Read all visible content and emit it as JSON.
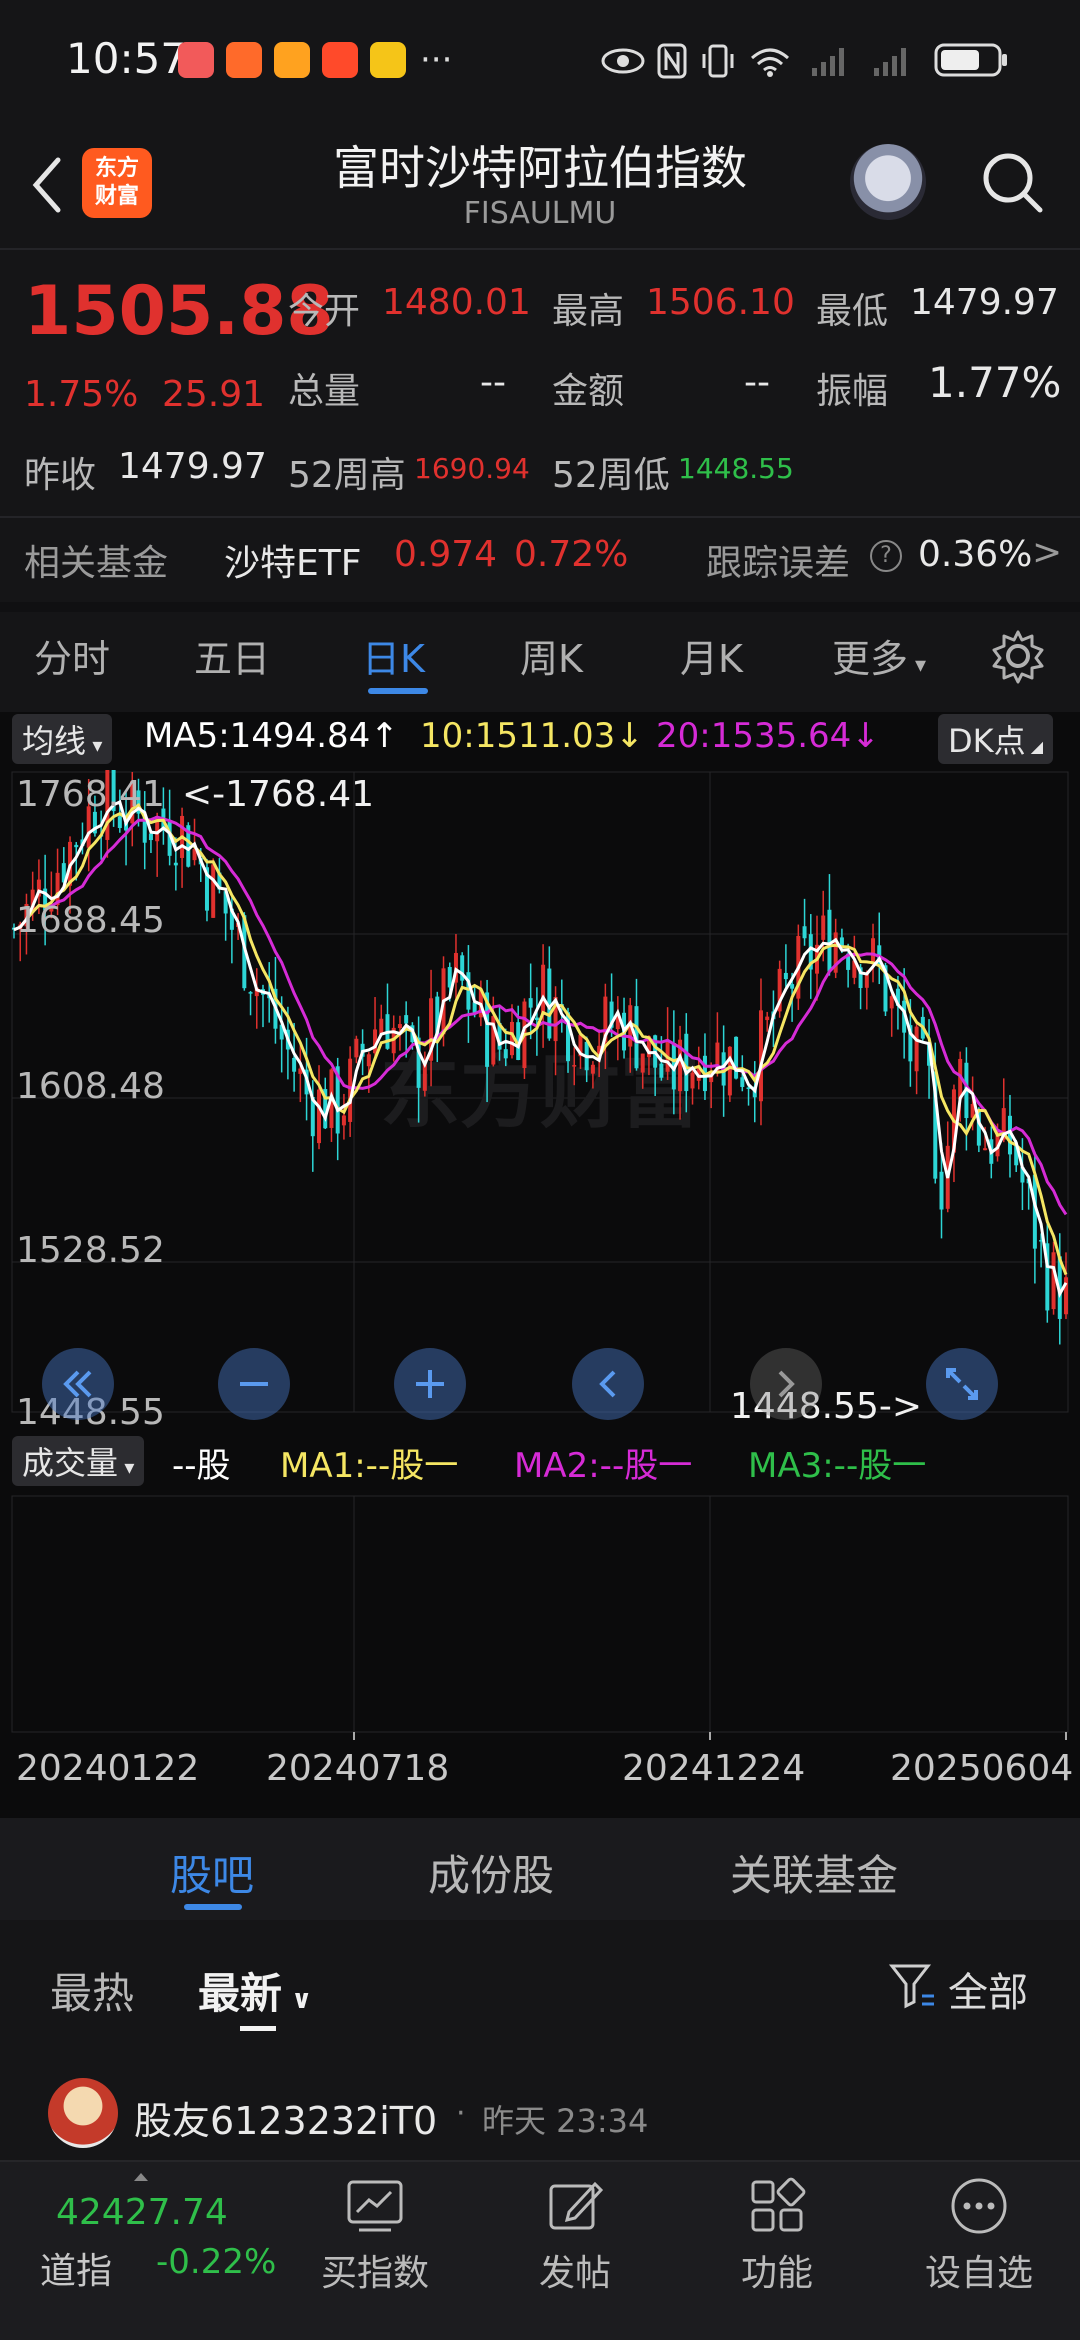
{
  "status": {
    "time": "10:57",
    "more": "···"
  },
  "header": {
    "logo_text": "东方\n财富",
    "title": "富时沙特阿拉伯指数",
    "code": "FISAULMU"
  },
  "quote": {
    "price": "1505.88",
    "change_pct": "1.75%",
    "change": "25.91",
    "open_label": "今开",
    "open": "1480.01",
    "high_label": "最高",
    "high": "1506.10",
    "low_label": "最低",
    "low": "1479.97",
    "volume_label": "总量",
    "volume": "--",
    "amount_label": "金额",
    "amount": "--",
    "amplitude_label": "振幅",
    "amplitude": "1.77%",
    "prev_close_label": "昨收",
    "prev_close": "1479.97",
    "w52_high_label": "52周高",
    "w52_high": "1690.94",
    "w52_low_label": "52周低",
    "w52_low": "1448.55"
  },
  "fund": {
    "label": "相关基金",
    "name": "沙特ETF",
    "price": "0.974",
    "pct": "0.72%",
    "tracking_label": "跟踪误差",
    "tracking_value": "0.36%",
    "arrow": ">"
  },
  "ktabs": [
    "分时",
    "五日",
    "日K",
    "周K",
    "月K",
    "更多"
  ],
  "ma_bar": {
    "chip": "均线",
    "ma5": "MA5:1494.84↑",
    "ma10": "10:1511.03↓",
    "ma20": "20:1535.64↓",
    "dk": "DK点"
  },
  "chart": {
    "y_labels": [
      "1768.41",
      "1688.45",
      "1608.48",
      "1528.52",
      "1448.55"
    ],
    "max_mark": "<-1768.41",
    "min_mark": "1448.55->",
    "watermark": "东方财富"
  },
  "volume_bar": {
    "chip": "成交量",
    "unit": "--股",
    "ma1": "MA1:--股一",
    "ma2": "MA2:--股一",
    "ma3": "MA3:--股一"
  },
  "x_labels": [
    "20240122",
    "20240718",
    "20241224",
    "20250604"
  ],
  "sections": [
    "股吧",
    "成份股",
    "关联基金"
  ],
  "filters": {
    "hot": "最热",
    "new": "最新",
    "all": "全部"
  },
  "post": {
    "user": "股友6123232iT0",
    "sep": "·",
    "time": "昨天 23:34"
  },
  "bottom_index": {
    "value": "42427.74",
    "name": "道指",
    "pct": "-0.22%"
  },
  "nav": [
    "买指数",
    "发帖",
    "功能",
    "设自选"
  ],
  "colors": {
    "up": "#e0312e",
    "down": "#2fbf4a",
    "accent": "#3d88e6",
    "ma5": "#ffffff",
    "ma10": "#f5e663",
    "ma20": "#d62bd6",
    "candle_down": "#2dd6d6"
  }
}
